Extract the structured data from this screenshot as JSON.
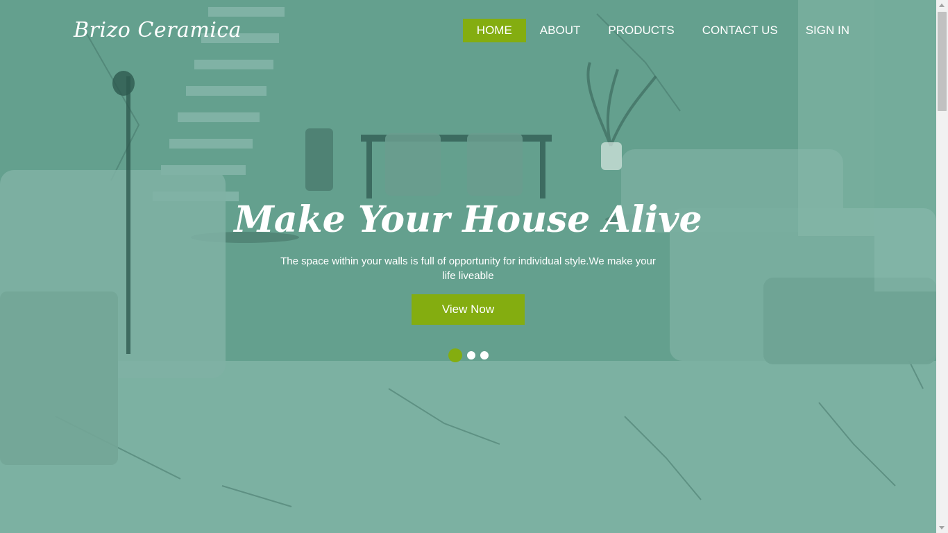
{
  "brand": {
    "name": "Brizo Ceramica"
  },
  "nav": {
    "items": [
      {
        "label": "HOME",
        "active": true
      },
      {
        "label": "ABOUT"
      },
      {
        "label": "PRODUCTS"
      },
      {
        "label": "CONTACT US"
      },
      {
        "label": "SIGN IN"
      }
    ]
  },
  "hero": {
    "title": "Make Your House Alive",
    "subtitle": "The space within your walls is full of opportunity for individual style.We make your life liveable",
    "cta_label": "View Now",
    "slides_total": 3,
    "active_slide": 1
  },
  "colors": {
    "accent": "#84ad10",
    "overlay": "#5f9c8a",
    "text": "#ffffff"
  }
}
